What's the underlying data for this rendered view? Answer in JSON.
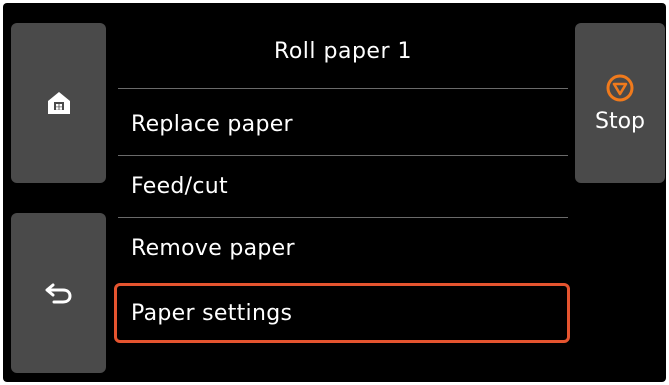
{
  "screen": {
    "title": "Roll paper 1",
    "stop_label": "Stop",
    "menu": [
      {
        "label": "Replace paper",
        "selected": false
      },
      {
        "label": "Feed/cut",
        "selected": false
      },
      {
        "label": "Remove paper",
        "selected": false
      },
      {
        "label": "Paper settings",
        "selected": true
      }
    ],
    "icons": {
      "home": "home-icon",
      "back": "back-arrow-icon",
      "stop": "stop-icon"
    },
    "colors": {
      "background": "#000000",
      "side_button": "#4a4a4a",
      "stop_icon": "#f07a1c",
      "selection_border": "#e5542f",
      "text": "#ffffff"
    }
  }
}
